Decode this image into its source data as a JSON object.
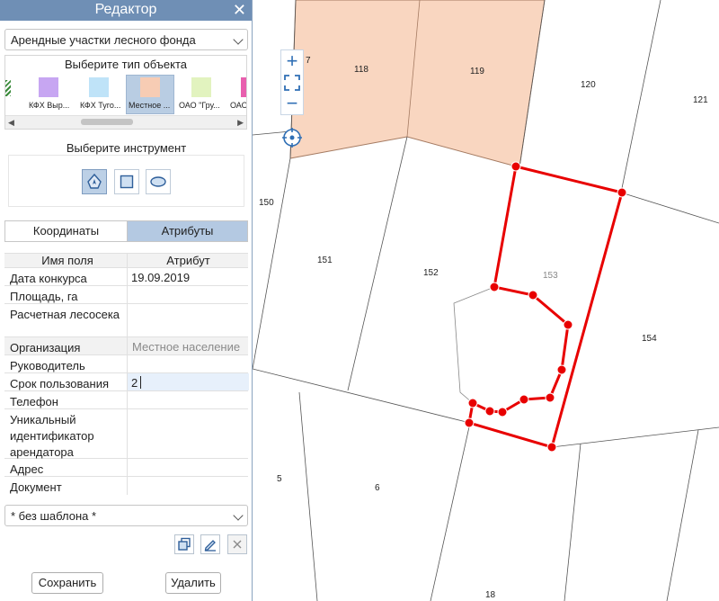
{
  "editor": {
    "title": "Редактор",
    "close_glyph": "✕",
    "layer_select": "Арендные участки лесного фонда",
    "object_type_header": "Выберите тип объекта",
    "object_types": [
      {
        "label": "КФХ Выр...",
        "color": "#c7a6f2"
      },
      {
        "label": "КФХ Туго...",
        "color": "#bfe3f8"
      },
      {
        "label": "Местное ...",
        "color": "#f7ccb4"
      },
      {
        "label": "ОАО \"Гру...",
        "color": "#e2f3bf"
      },
      {
        "label": "ОАО",
        "color": "#e85fae"
      }
    ],
    "tool_header": "Выберите инструмент",
    "tools": [
      "polygon-tool-icon",
      "rectangle-tool-icon",
      "ellipse-tool-icon"
    ],
    "tabs": [
      "Координаты",
      "Атрибуты"
    ],
    "active_tab": "Атрибуты",
    "table_header": [
      "Имя поля",
      "Атрибут"
    ],
    "rows": [
      {
        "field": "Дата конкурса",
        "value": "19.09.2019"
      },
      {
        "field": "Площадь, га",
        "value": ""
      },
      {
        "field": "Расчетная лесосека",
        "value": ""
      },
      {
        "field": "Организация",
        "value": "Местное население"
      },
      {
        "field": "Руководитель",
        "value": ""
      },
      {
        "field": "Срок пользования",
        "value": "2"
      },
      {
        "field": "Телефон",
        "value": ""
      },
      {
        "field": "Уникальный идентификатор арендатора",
        "value": ""
      },
      {
        "field": "Адрес",
        "value": ""
      },
      {
        "field": "Документ",
        "value": ""
      }
    ],
    "template_select": "* без шаблона *",
    "save_label": "Сохранить",
    "delete_label": "Удалить"
  },
  "map": {
    "zoom_in": "+",
    "zoom_out": "−",
    "parcels": [
      {
        "id": "7"
      },
      {
        "id": "118"
      },
      {
        "id": "119"
      },
      {
        "id": "120"
      },
      {
        "id": "121"
      },
      {
        "id": "150"
      },
      {
        "id": "151"
      },
      {
        "id": "152"
      },
      {
        "id": "153"
      },
      {
        "id": "154"
      },
      {
        "id": "5"
      },
      {
        "id": "6"
      },
      {
        "id": "18"
      }
    ],
    "colors": {
      "highlight_fill": "#f9d6c0",
      "edit_stroke": "#e80000",
      "ui_accent": "#6f8fb5"
    }
  }
}
